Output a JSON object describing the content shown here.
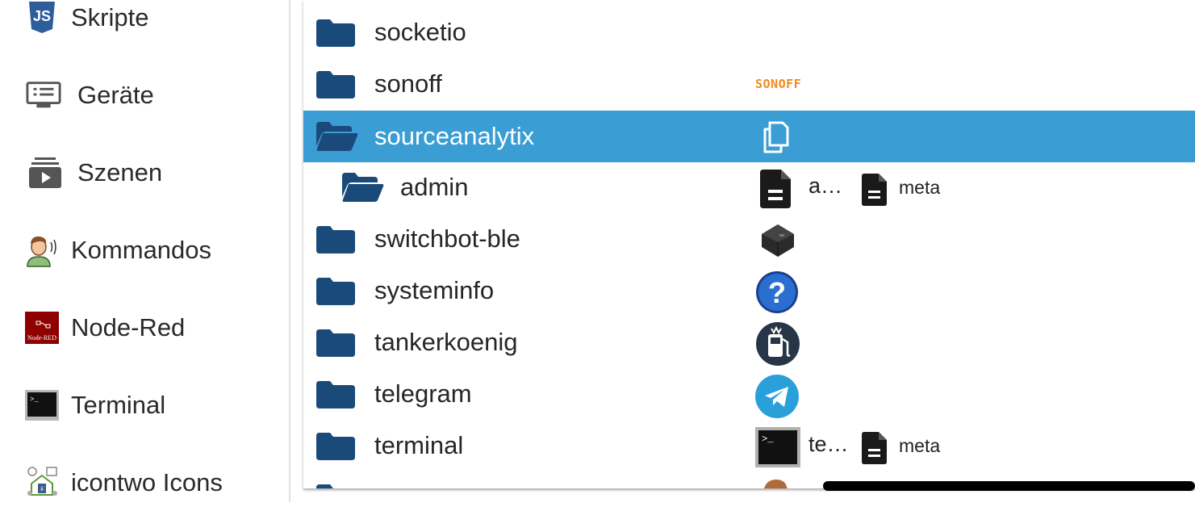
{
  "sidebar": {
    "items": [
      {
        "label": "Skripte",
        "icon": "js-icon"
      },
      {
        "label": "Geräte",
        "icon": "devices-icon"
      },
      {
        "label": "Szenen",
        "icon": "scenes-icon"
      },
      {
        "label": "Kommandos",
        "icon": "commands-icon"
      },
      {
        "label": "Node-Red",
        "icon": "node-red-icon",
        "icon_text": "Node-RED"
      },
      {
        "label": "Terminal",
        "icon": "terminal-icon"
      },
      {
        "label": "icontwo Icons",
        "icon": "icontwo-icon"
      }
    ]
  },
  "tree": {
    "rows": [
      {
        "name": "socketio"
      },
      {
        "name": "sonoff",
        "logo_text": "SONOFF"
      },
      {
        "name": "sourceanalytix",
        "selected": true
      },
      {
        "name": "admin",
        "file1": "a…",
        "file2": "meta"
      },
      {
        "name": "switchbot-ble"
      },
      {
        "name": "systeminfo"
      },
      {
        "name": "tankerkoenig"
      },
      {
        "name": "telegram"
      },
      {
        "name": "terminal",
        "file1": "te…",
        "file2": "meta"
      }
    ]
  },
  "colors": {
    "folder": "#1a4a7a",
    "selected_row": "#3a9dd4",
    "sonoff_orange": "#f08a1c"
  }
}
